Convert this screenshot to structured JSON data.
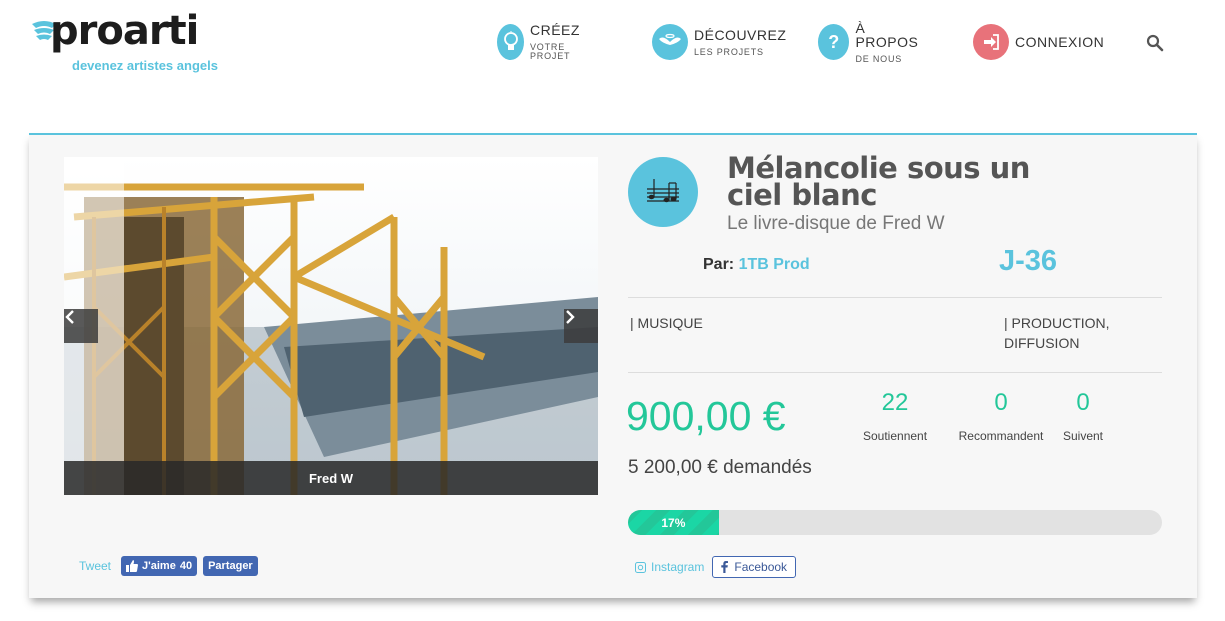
{
  "header": {
    "logo_word": "proarti",
    "logo_tagline": "devenez artistes angels",
    "nav": [
      {
        "label": "CRÉEZ",
        "sub": "VOTRE PROJET",
        "icon": "lightbulb-icon",
        "color": "#5ac3dd"
      },
      {
        "label": "DÉCOUVREZ",
        "sub": "LES PROJETS",
        "icon": "angel-wings-icon",
        "color": "#5ac3dd"
      },
      {
        "label": "À PROPOS",
        "sub": "DE NOUS",
        "icon": "question-icon",
        "color": "#5ac3dd"
      },
      {
        "label": "CONNEXION",
        "sub": "",
        "icon": "sign-in-icon",
        "color": "#e8727a"
      }
    ],
    "search_icon": "search-icon"
  },
  "carousel": {
    "caption": "Fred W",
    "prev_icon": "chevron-left-icon",
    "next_icon": "chevron-right-icon"
  },
  "share": {
    "tweet": "Tweet",
    "like_label": "J'aime",
    "like_count": "40",
    "share_label": "Partager"
  },
  "project": {
    "icon": "music-notes-icon",
    "title": "Mélancolie sous un ciel blanc",
    "subtitle": "Le livre-disque de Fred W",
    "by_label": "Par:",
    "author": "1TB Prod",
    "countdown": "J-36",
    "category_1": "| MUSIQUE",
    "category_2": "| PRODUCTION, DIFFUSION",
    "amount": "900,00 €",
    "goal": "5 200,00 € demandés",
    "stats": [
      {
        "value": "22",
        "label": "Soutiennent"
      },
      {
        "value": "0",
        "label": "Recommandent"
      },
      {
        "value": "0",
        "label": "Suivent"
      }
    ],
    "progress_percent": 17,
    "progress_label": "17%",
    "instagram": "Instagram",
    "facebook": "Facebook"
  },
  "colors": {
    "accent": "#5ac3dd",
    "green": "#23c799",
    "red": "#e8727a",
    "facebook": "#4267b2"
  }
}
